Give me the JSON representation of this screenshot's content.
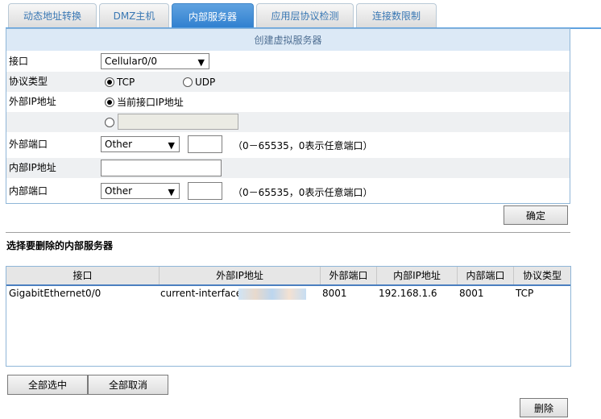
{
  "tabs": [
    "动态地址转换",
    "DMZ主机",
    "内部服务器",
    "应用层协议检测",
    "连接数限制"
  ],
  "create": {
    "title": "创建虚拟服务器",
    "interface_label": "接口",
    "interface_value": "Cellular0/0",
    "protocol_label": "协议类型",
    "protocol_tcp": "TCP",
    "protocol_udp": "UDP",
    "protocol_selected": "TCP",
    "external_ip_label": "外部IP地址",
    "external_ip_option": "当前接口IP地址",
    "external_ip_value": "",
    "external_port_label": "外部端口",
    "external_port_select": "Other",
    "external_port_value": "",
    "port_hint": "（0－65535，0表示任意端口）",
    "internal_ip_label": "内部IP地址",
    "internal_ip_value": "",
    "internal_port_label": "内部端口",
    "internal_port_select": "Other",
    "internal_port_value": "",
    "confirm_label": "确定"
  },
  "delete": {
    "section_title": "选择要删除的内部服务器",
    "columns": [
      "接口",
      "外部IP地址",
      "外部端口",
      "内部IP地址",
      "内部端口",
      "协议类型"
    ],
    "rows": [
      {
        "interface": "GigabitEthernet0/0",
        "external_ip": "current-interface(",
        "external_port": "8001",
        "internal_ip": "192.168.1.6",
        "internal_port": "8001",
        "protocol": "TCP"
      }
    ],
    "select_all_label": "全部选中",
    "deselect_all_label": "全部取消",
    "delete_label": "删除"
  }
}
